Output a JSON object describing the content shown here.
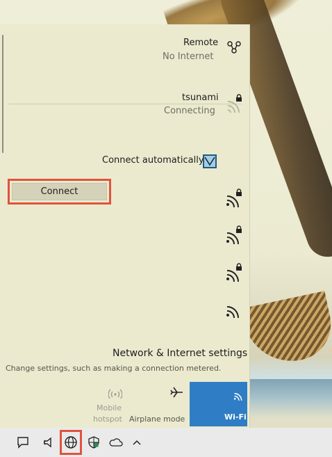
{
  "networks": {
    "remote": {
      "name": "Remote",
      "status": "No Internet"
    },
    "tsunami": {
      "name": "tsunami",
      "status": "Connecting"
    },
    "connect_automatically_label": "Connect automatically",
    "connect_automatically_checked": true,
    "connect_button_label": "Connect",
    "other_networks": [
      {
        "icon": "wifi-secured-icon"
      },
      {
        "icon": "wifi-secured-icon"
      },
      {
        "icon": "wifi-secured-icon"
      },
      {
        "icon": "wifi-icon"
      }
    ]
  },
  "network_settings": {
    "title": "Network & Internet settings",
    "description": "Change settings, such as making a connection metered."
  },
  "quick_actions": {
    "wifi": {
      "label": "Wi-Fi",
      "active": true
    },
    "airplane": {
      "label": "Airplane mode"
    },
    "hotspot": {
      "label_line1": "Mobile",
      "label_line2": "hotspot",
      "disabled": true
    }
  },
  "taskbar": {
    "icons": [
      "chevron-up-icon",
      "onedrive-icon",
      "security-icon",
      "network-icon",
      "volume-icon",
      "notification-icon"
    ]
  },
  "colors": {
    "accent": "#2f7dc4",
    "highlight": "#e0533d",
    "panel": "#ebeacf"
  }
}
